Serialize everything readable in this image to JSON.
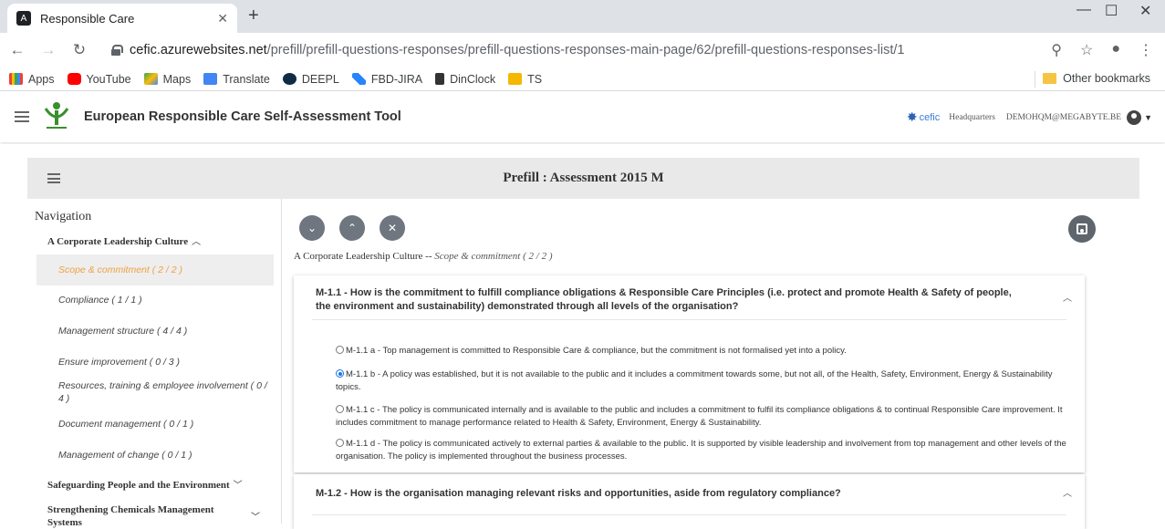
{
  "browser": {
    "tab_title": "Responsible Care",
    "url_host": "cefic.azurewebsites.net",
    "url_path": "/prefill/prefill-questions-responses/prefill-questions-responses-main-page/62/prefill-questions-responses-list/1",
    "bookmarks": [
      "Apps",
      "YouTube",
      "Maps",
      "Translate",
      "DEEPL",
      "FBD-JIRA",
      "DinClock",
      "TS"
    ],
    "other_bookmarks": "Other bookmarks"
  },
  "header": {
    "title": "European Responsible Care Self-Assessment Tool",
    "cefic": "cefic",
    "org": "Headquarters",
    "user": "DEMOHQM@MEGABYTE.BE"
  },
  "panel": {
    "title": "Prefill : Assessment 2015 M"
  },
  "sidebar": {
    "nav_title": "Navigation",
    "section1": "A Corporate Leadership Culture",
    "items": [
      "Scope & commitment ( 2 / 2 )",
      "Compliance ( 1 / 1 )",
      "Management structure ( 4 / 4 )",
      "Ensure improvement ( 0 / 3 )",
      "Resources, training & employee involvement ( 0 / 4 )",
      "Document management ( 0 / 1 )",
      "Management of change ( 0 / 1 )"
    ],
    "section2": "Safeguarding People and the Environment",
    "section3": "Strengthening Chemicals Management Systems"
  },
  "main": {
    "crumb_section": "A Corporate Leadership Culture --",
    "crumb_sub": "Scope & commitment ( 2 / 2 )",
    "q1": "M-1.1 - How is the commitment to fulfill compliance obligations & Responsible Care Principles (i.e. protect and promote Health & Safety of people, the environment and sustainability) demonstrated through all levels of the organisation?",
    "options": [
      "M-1.1 a - Top management is committed to Responsible Care & compliance, but the commitment is not formalised yet into a policy.",
      "M-1.1 b - A policy was established, but it is not available to the public and it includes a commitment towards some, but not all, of the Health, Safety, Environment, Energy & Sustainability topics.",
      "M-1.1 c - The policy is communicated internally and is available to the public and includes a commitment to fulfil its compliance obligations & to continual Responsible Care improvement. It includes commitment to manage performance related to Health & Safety, Environment, Energy & Sustainability.",
      "M-1.1 d - The policy is communicated actively to external parties & available to the public. It is supported by visible leadership and involvement from top management and other levels of the organisation. The policy is implemented throughout the business processes."
    ],
    "selected_option": 1,
    "q2": "M-1.2 - How is the organisation managing relevant risks and opportunities, aside from regulatory compliance?"
  }
}
